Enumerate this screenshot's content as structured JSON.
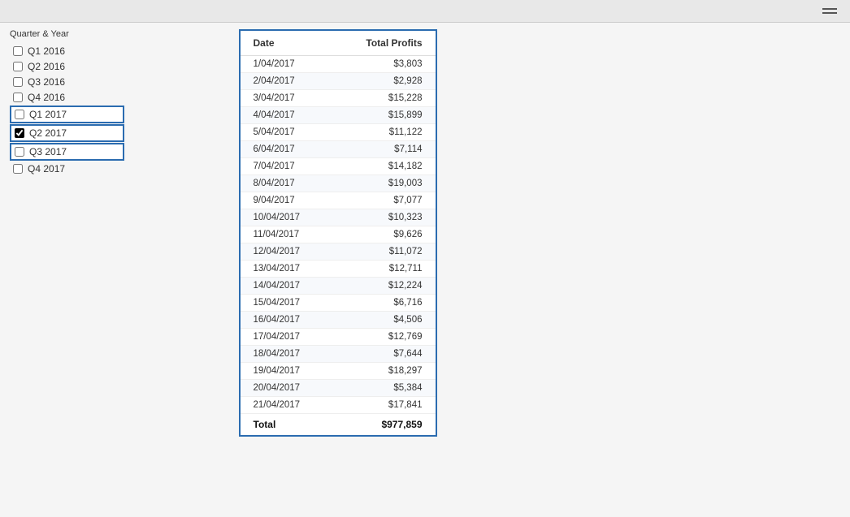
{
  "topbar": {
    "hamburger_label": "menu"
  },
  "sidebar": {
    "title": "Quarter & Year",
    "items": [
      {
        "label": "Q1 2016",
        "checked": false,
        "highlighted": false
      },
      {
        "label": "Q2 2016",
        "checked": false,
        "highlighted": false
      },
      {
        "label": "Q3 2016",
        "checked": false,
        "highlighted": false
      },
      {
        "label": "Q4 2016",
        "checked": false,
        "highlighted": false
      },
      {
        "label": "Q1 2017",
        "checked": false,
        "highlighted": true
      },
      {
        "label": "Q2 2017",
        "checked": true,
        "highlighted": true
      },
      {
        "label": "Q3 2017",
        "checked": false,
        "highlighted": true
      },
      {
        "label": "Q4 2017",
        "checked": false,
        "highlighted": false
      }
    ]
  },
  "table": {
    "col_date": "Date",
    "col_profits": "Total Profits",
    "rows": [
      {
        "date": "1/04/2017",
        "profit": "$3,803"
      },
      {
        "date": "2/04/2017",
        "profit": "$2,928"
      },
      {
        "date": "3/04/2017",
        "profit": "$15,228"
      },
      {
        "date": "4/04/2017",
        "profit": "$15,899"
      },
      {
        "date": "5/04/2017",
        "profit": "$11,122"
      },
      {
        "date": "6/04/2017",
        "profit": "$7,114"
      },
      {
        "date": "7/04/2017",
        "profit": "$14,182"
      },
      {
        "date": "8/04/2017",
        "profit": "$19,003"
      },
      {
        "date": "9/04/2017",
        "profit": "$7,077"
      },
      {
        "date": "10/04/2017",
        "profit": "$10,323"
      },
      {
        "date": "11/04/2017",
        "profit": "$9,626"
      },
      {
        "date": "12/04/2017",
        "profit": "$11,072"
      },
      {
        "date": "13/04/2017",
        "profit": "$12,711"
      },
      {
        "date": "14/04/2017",
        "profit": "$12,224"
      },
      {
        "date": "15/04/2017",
        "profit": "$6,716"
      },
      {
        "date": "16/04/2017",
        "profit": "$4,506"
      },
      {
        "date": "17/04/2017",
        "profit": "$12,769"
      },
      {
        "date": "18/04/2017",
        "profit": "$7,644"
      },
      {
        "date": "19/04/2017",
        "profit": "$18,297"
      },
      {
        "date": "20/04/2017",
        "profit": "$5,384"
      },
      {
        "date": "21/04/2017",
        "profit": "$17,841"
      }
    ],
    "total_label": "Total",
    "total_value": "$977,859"
  }
}
